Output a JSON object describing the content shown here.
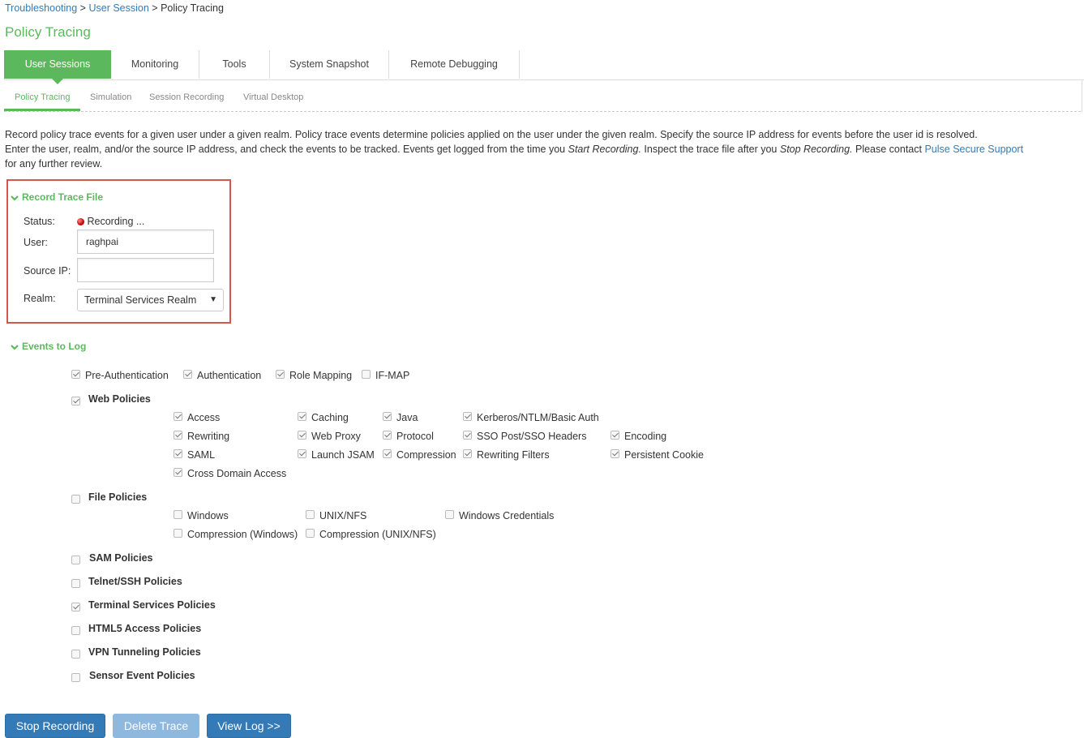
{
  "breadcrumb": {
    "item1": "Troubleshooting",
    "sep": ">",
    "item2": "User Session",
    "current": "Policy Tracing"
  },
  "page_title": "Policy Tracing",
  "tabs": [
    {
      "label": "User Sessions",
      "active": true
    },
    {
      "label": "Monitoring"
    },
    {
      "label": "Tools"
    },
    {
      "label": "System Snapshot"
    },
    {
      "label": "Remote Debugging"
    }
  ],
  "subtabs": [
    {
      "label": "Policy Tracing",
      "active": true
    },
    {
      "label": "Simulation"
    },
    {
      "label": "Session Recording"
    },
    {
      "label": "Virtual Desktop"
    }
  ],
  "description": {
    "line1": "Record policy trace events for a given user under a given realm. Policy trace events determine policies applied on the user under the given realm. Specify the source IP address for events before the user id is resolved.",
    "line2a": "Enter the user, realm, and/or the source IP address, and check the events to be tracked. Events get logged from the time you ",
    "line2b": "Start Recording.",
    "line2c": " Inspect the trace file after you ",
    "line2d": "Stop Recording.",
    "line2e": " Please contact ",
    "link": "Pulse Secure Support",
    "line3": "for any further review."
  },
  "record_trace": {
    "title": "Record Trace File",
    "status_label": "Status:",
    "status_value": "Recording ...",
    "user_label": "User:",
    "user_value": "raghpai",
    "source_ip_label": "Source IP:",
    "source_ip_value": "",
    "realm_label": "Realm:",
    "realm_value": "Terminal Services Realm"
  },
  "events": {
    "title": "Events to Log",
    "top": [
      {
        "label": "Pre-Authentication",
        "checked": true
      },
      {
        "label": "Authentication",
        "checked": true
      },
      {
        "label": "Role Mapping",
        "checked": true
      },
      {
        "label": "IF-MAP",
        "checked": false
      }
    ],
    "web_policies": {
      "label": "Web Policies",
      "checked": true,
      "items": [
        {
          "label": "Access",
          "checked": true
        },
        {
          "label": "Caching",
          "checked": true
        },
        {
          "label": "Java",
          "checked": true
        },
        {
          "label": "Kerberos/NTLM/Basic Auth",
          "checked": true
        },
        {
          "label": "Rewriting",
          "checked": true
        },
        {
          "label": "Web Proxy",
          "checked": true
        },
        {
          "label": "Protocol",
          "checked": true
        },
        {
          "label": "SSO Post/SSO Headers",
          "checked": true
        },
        {
          "label": "Encoding",
          "checked": true
        },
        {
          "label": "SAML",
          "checked": true
        },
        {
          "label": "Launch JSAM",
          "checked": true
        },
        {
          "label": "Compression",
          "checked": true
        },
        {
          "label": "Rewriting Filters",
          "checked": true
        },
        {
          "label": "Persistent Cookie",
          "checked": true
        },
        {
          "label": "Cross Domain Access",
          "checked": true
        }
      ]
    },
    "file_policies": {
      "label": "File Policies",
      "checked": false,
      "items": [
        {
          "label": "Windows",
          "checked": false
        },
        {
          "label": "UNIX/NFS",
          "checked": false
        },
        {
          "label": "Windows Credentials",
          "checked": false
        },
        {
          "label": "Compression (Windows)",
          "checked": false
        },
        {
          "label": "Compression (UNIX/NFS)",
          "checked": false
        }
      ]
    },
    "others": [
      {
        "label": "SAM Policies",
        "checked": false
      },
      {
        "label": "Telnet/SSH Policies",
        "checked": false
      },
      {
        "label": "Terminal Services Policies",
        "checked": true
      },
      {
        "label": "HTML5 Access Policies",
        "checked": false
      },
      {
        "label": "VPN Tunneling Policies",
        "checked": false
      },
      {
        "label": "Sensor Event Policies",
        "checked": false
      }
    ]
  },
  "buttons": {
    "stop": "Stop Recording",
    "delete": "Delete Trace",
    "view": "View Log >>"
  },
  "colors": {
    "accent_green": "#5cb85c",
    "link_blue": "#337ab7",
    "highlight_red": "#d9534f"
  }
}
